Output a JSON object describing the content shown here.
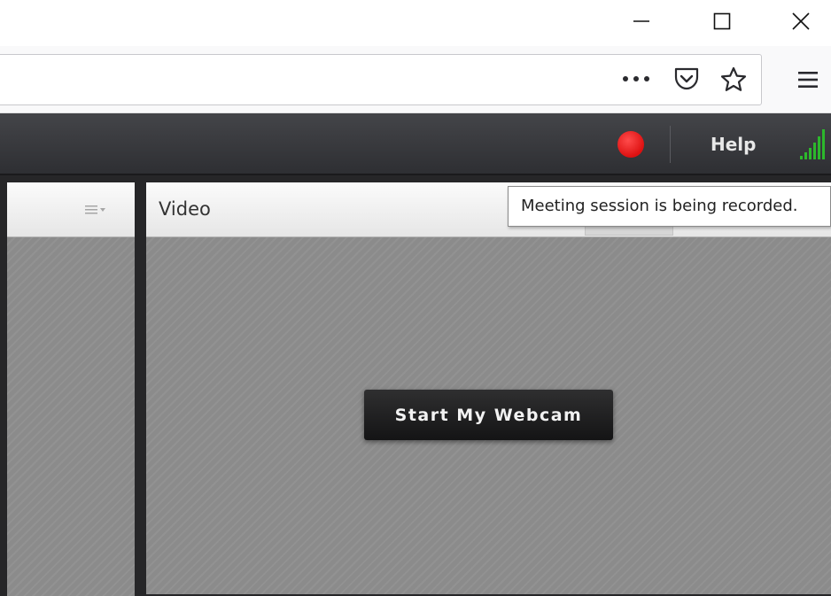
{
  "window_controls": {
    "minimize_icon": "minimize-icon",
    "maximize_icon": "maximize-icon",
    "close_icon": "close-icon"
  },
  "toolbar": {
    "url_value": "",
    "page_actions_icon": "more-horizontal-icon",
    "pocket_icon": "pocket-icon",
    "bookmark_icon": "star-icon",
    "menu_icon": "hamburger-icon"
  },
  "app_header": {
    "recording_indicator_color": "#e11b1b",
    "help_label": "Help",
    "signal_color": "#2cb82c"
  },
  "pods": {
    "left": {
      "menu_icon": "pod-menu-icon"
    },
    "video": {
      "title": "Video",
      "start_webcam_label": "Start My Webcam"
    }
  },
  "tooltip": {
    "text": "Meeting session is being recorded."
  },
  "colors": {
    "app_header_bg": "#3b3c40",
    "pod_bg": "#8b8b8b",
    "button_bg": "#222223"
  }
}
